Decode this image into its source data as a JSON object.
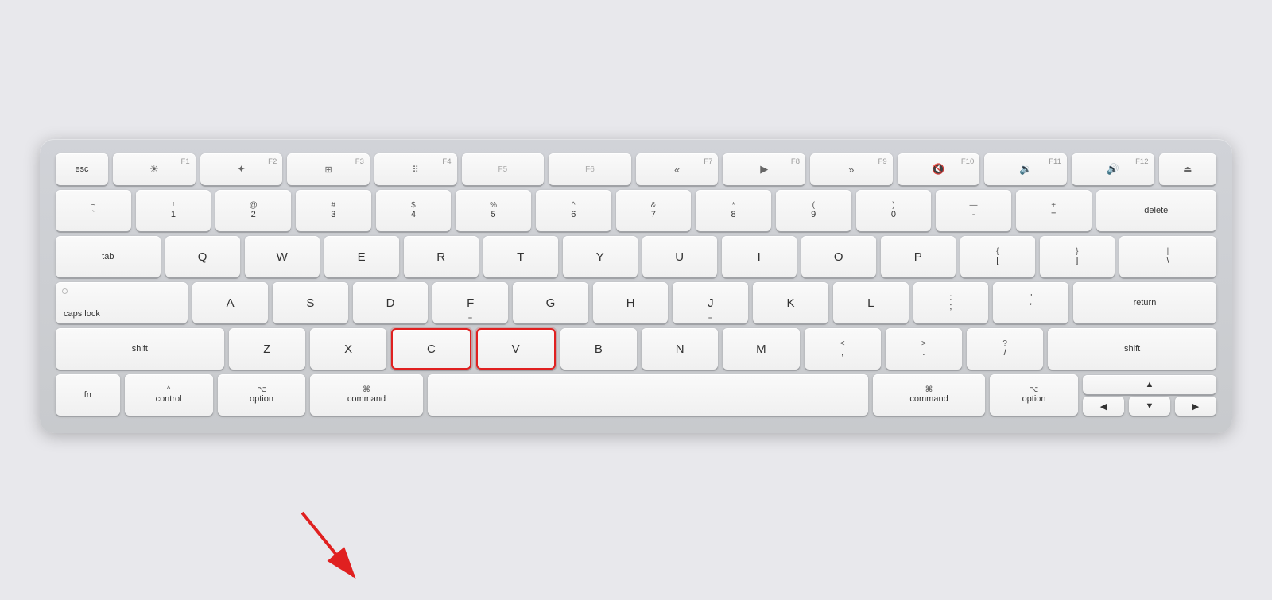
{
  "keyboard": {
    "rows": {
      "frow": [
        "esc",
        "F1",
        "F2",
        "F3",
        "F4",
        "F5",
        "F6",
        "F7",
        "F8",
        "F9",
        "F10",
        "F11",
        "F12",
        "eject"
      ],
      "row1": [
        "~`",
        "!1",
        "@2",
        "#3",
        "$4",
        "%5",
        "^6",
        "&7",
        "*8",
        "(9",
        ")0",
        "-",
        "=",
        "+",
        "delete"
      ],
      "row2": [
        "tab",
        "Q",
        "W",
        "E",
        "R",
        "T",
        "Y",
        "U",
        "I",
        "O",
        "P",
        "{[",
        "}]",
        "\\|"
      ],
      "row3": [
        "caps lock",
        "A",
        "S",
        "D",
        "F",
        "G",
        "H",
        "J",
        "K",
        "L",
        ";:",
        "'\"",
        "return"
      ],
      "row4": [
        "shift",
        "Z",
        "X",
        "C",
        "V",
        "B",
        "N",
        "M",
        "<,",
        ">.",
        "?/",
        "shift"
      ],
      "row5": [
        "fn",
        "control",
        "option",
        "command",
        "space",
        "command",
        "option",
        "arrows"
      ]
    }
  },
  "labels": {
    "esc": "esc",
    "f1": "F1",
    "f2": "F2",
    "f3": "F3",
    "f4": "F4",
    "f5": "F5",
    "f6": "F6",
    "f7": "F7",
    "f8": "F8",
    "f9": "F9",
    "f10": "F10",
    "f11": "F11",
    "f12": "F12",
    "delete": "delete",
    "tab": "tab",
    "caps_lock": "caps lock",
    "return": "return",
    "shift": "shift",
    "fn": "fn",
    "control": "control",
    "option": "option",
    "command": "command",
    "c_key": "C",
    "v_key": "V",
    "highlighted_note": "C and V keys are highlighted"
  }
}
